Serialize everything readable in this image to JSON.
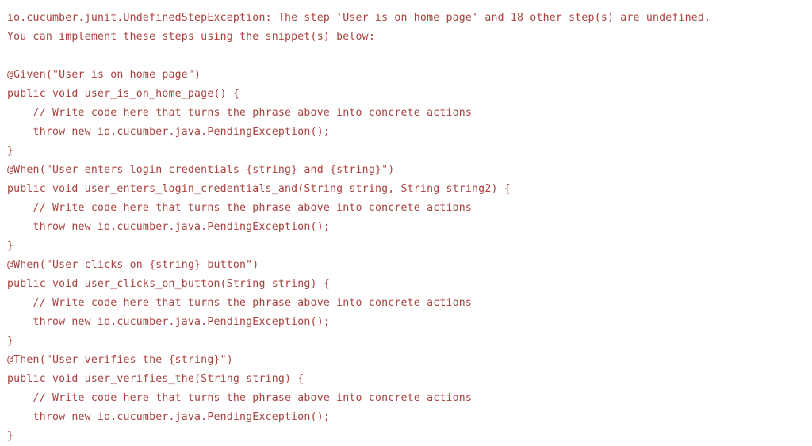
{
  "console": {
    "title": "Cucumber UndefinedStepException console output",
    "text_color": "#a9423f",
    "background_color": "#ffffff",
    "exception_type": "io.cucumber.junit.UndefinedStepException",
    "undefined_step_name": "User is on home page",
    "other_undefined_step_count": "18",
    "lines": [
      "io.cucumber.junit.UndefinedStepException: The step 'User is on home page' and 18 other step(s) are undefined.",
      "You can implement these steps using the snippet(s) below:",
      "",
      "@Given(\"User is on home page\")",
      "public void user_is_on_home_page() {",
      "    // Write code here that turns the phrase above into concrete actions",
      "    throw new io.cucumber.java.PendingException();",
      "}",
      "@When(\"User enters login credentials {string} and {string}\")",
      "public void user_enters_login_credentials_and(String string, String string2) {",
      "    // Write code here that turns the phrase above into concrete actions",
      "    throw new io.cucumber.java.PendingException();",
      "}",
      "@When(\"User clicks on {string} button\")",
      "public void user_clicks_on_button(String string) {",
      "    // Write code here that turns the phrase above into concrete actions",
      "    throw new io.cucumber.java.PendingException();",
      "}",
      "@Then(\"User verifies the {string}\")",
      "public void user_verifies_the(String string) {",
      "    // Write code here that turns the phrase above into concrete actions",
      "    throw new io.cucumber.java.PendingException();",
      "}"
    ]
  }
}
